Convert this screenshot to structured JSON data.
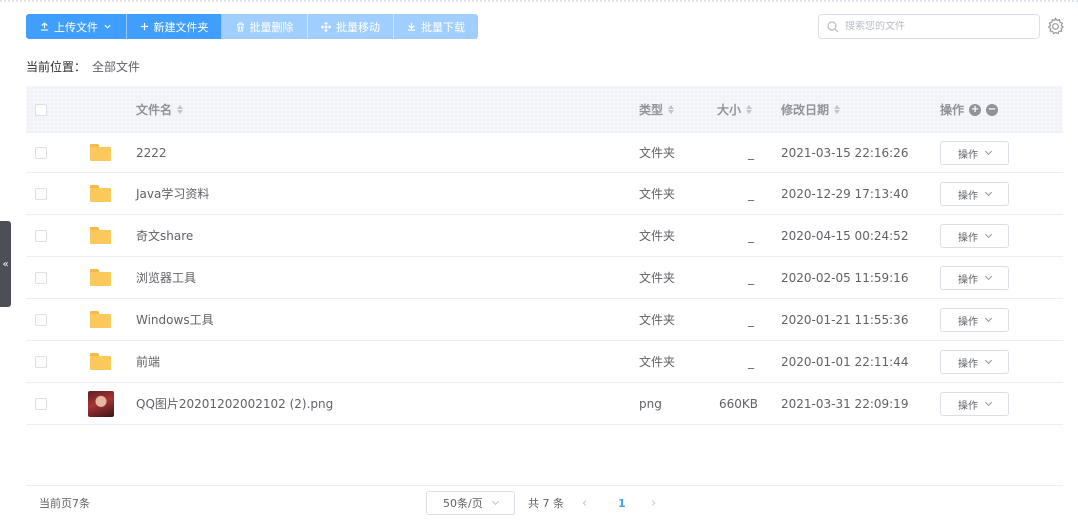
{
  "toolbar": {
    "upload": "上传文件",
    "new_folder": "新建文件夹",
    "batch_delete": "批量删除",
    "batch_move": "批量移动",
    "batch_download": "批量下载"
  },
  "search": {
    "placeholder": "搜索您的文件"
  },
  "breadcrumb": {
    "label": "当前位置：",
    "current": "全部文件"
  },
  "table": {
    "headers": {
      "name": "文件名",
      "type": "类型",
      "size": "大小",
      "date": "修改日期",
      "action": "操作"
    },
    "rows": [
      {
        "name": "2222",
        "type": "文件夹",
        "size": "_",
        "date": "2021-03-15 22:16:26",
        "action": "操作",
        "icon": "folder-icon"
      },
      {
        "name": "Java学习资料",
        "type": "文件夹",
        "size": "_",
        "date": "2020-12-29 17:13:40",
        "action": "操作",
        "icon": "folder-icon"
      },
      {
        "name": "奇文share",
        "type": "文件夹",
        "size": "_",
        "date": "2020-04-15 00:24:52",
        "action": "操作",
        "icon": "folder-icon"
      },
      {
        "name": "浏览器工具",
        "type": "文件夹",
        "size": "_",
        "date": "2020-02-05 11:59:16",
        "action": "操作",
        "icon": "folder-icon"
      },
      {
        "name": "Windows工具",
        "type": "文件夹",
        "size": "_",
        "date": "2020-01-21 11:55:36",
        "action": "操作",
        "icon": "folder-icon"
      },
      {
        "name": "前端",
        "type": "文件夹",
        "size": "_",
        "date": "2020-01-01 22:11:44",
        "action": "操作",
        "icon": "folder-icon"
      },
      {
        "name": "QQ图片20201202002102 (2).png",
        "type": "png",
        "size": "660KB",
        "date": "2021-03-31 22:09:19",
        "action": "操作",
        "icon": "image-thumbnail"
      }
    ]
  },
  "footer": {
    "count": "当前页7条",
    "page_size": "50条/页",
    "total": "共 7 条",
    "current_page": "1"
  },
  "colors": {
    "primary": "#409eff",
    "primary_disabled": "#a0cfff",
    "folder": "#fbc85b"
  }
}
